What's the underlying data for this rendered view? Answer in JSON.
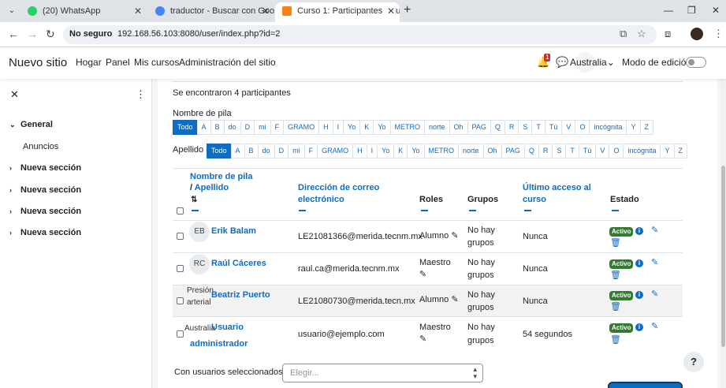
{
  "browser": {
    "tabs": [
      {
        "title": "(20) WhatsApp",
        "close": "✕",
        "color": "#25d366"
      },
      {
        "title": "traductor - Buscar con Google",
        "close": "✕",
        "color": "#4285f4"
      },
      {
        "title": "Curso 1: Participantes | Nuevo s",
        "close": "✕",
        "color": "#f98012"
      }
    ],
    "new_tab": "+",
    "tab_menu": "⌄",
    "window_controls": {
      "minimize": "—",
      "maximize": "❐",
      "close": "✕"
    },
    "nav": {
      "back": "←",
      "forward": "→",
      "reload": "↻"
    },
    "security_label": "No seguro",
    "url": "192.168.56.103:8080/user/index.php?id=2",
    "icons": {
      "translate": "⧉",
      "star": "☆",
      "extensions": "⧈",
      "menu": "⋮"
    }
  },
  "navbar": {
    "site_name": "Nuevo sitio",
    "links": [
      "Hogar",
      "Panel",
      "Mis cursos",
      "Administración del sitio"
    ],
    "notif_count": "1",
    "bell": "🔔",
    "chat": "💬",
    "language": "Australia",
    "lang_caret": "⌄",
    "edit_mode_label": "Modo de edición"
  },
  "drawer": {
    "close": "✕",
    "kebab": "⋮",
    "sections": [
      {
        "label": "General",
        "chev": "⌄"
      },
      {
        "label": "Nueva sección",
        "chev": "›"
      },
      {
        "label": "Nueva sección",
        "chev": "›"
      },
      {
        "label": "Nueva sección",
        "chev": "›"
      },
      {
        "label": "Nueva sección",
        "chev": "›"
      }
    ],
    "sub_item": "Anuncios"
  },
  "main": {
    "found_text": "Se encontraron 4 participantes",
    "first_name_filter_label": "Nombre de pila",
    "last_name_filter_label": "Apellido",
    "first_letters": [
      "Todo",
      "A",
      "B",
      "do",
      "D",
      "mi",
      "F",
      "GRAMO",
      "H",
      "I",
      "Yo",
      "K",
      "Yo",
      "METRO",
      "norte",
      "Oh",
      "PAG",
      "Q",
      "R",
      "S",
      "T",
      "Tú",
      "V",
      "O",
      "incógnita",
      "Y",
      "Z"
    ],
    "last_letters": [
      "Todo",
      "A",
      "B",
      "do",
      "D",
      "mi",
      "F",
      "GRAMO",
      "H",
      "I",
      "Yo",
      "K",
      "Yo",
      "METRO",
      "norte",
      "Oh",
      "PAG",
      "Q",
      "R",
      "S",
      "T",
      "Tú",
      "V",
      "O",
      "incógnita",
      "Y",
      "Z"
    ],
    "headers": {
      "name_line1": "Nombre de pila",
      "name_sep": "/",
      "name_line2": "Apellido",
      "sort_icon": "⇅",
      "email_line1": "Dirección de correo",
      "email_line2": "electrónico",
      "roles": "Roles",
      "groups": "Grupos",
      "last_access_line1": "Último acceso al",
      "last_access_line2": "curso",
      "status": "Estado"
    },
    "rows": [
      {
        "initials": "EB",
        "overlay": "",
        "name_line1": "Erik Balam",
        "name_line2": "",
        "email": "LE21081366@merida.tecnm.mx",
        "role": "Alumno",
        "groups_line1": "No hay",
        "groups_line2": "grupos",
        "last_access": "Nunca",
        "status": "Activo"
      },
      {
        "initials": "RC",
        "overlay": "",
        "name_line1": "Raúl Cáceres",
        "name_line2": "",
        "email": "raul.ca@merida.tecnm.mx",
        "role": "Maestro",
        "groups_line1": "No hay",
        "groups_line2": "grupos",
        "last_access": "Nunca",
        "status": "Activo"
      },
      {
        "initials": "",
        "overlay_line1": "Presión",
        "overlay_line2": "arterial",
        "name_line1": "Beatriz Puerto",
        "name_line2": "",
        "email": "LE21080730@merida.tecn.mx",
        "role": "Alumno",
        "groups_line1": "No hay",
        "groups_line2": "grupos",
        "last_access": "Nunca",
        "status": "Activo"
      },
      {
        "initials": "",
        "overlay_line1": "Australia",
        "overlay_line2": "",
        "name_line1": "Usuario",
        "name_line2": "administrador",
        "email": "usuario@ejemplo.com",
        "role": "Maestro",
        "groups_line1": "No hay",
        "groups_line2": "grupos",
        "last_access": "54 segundos",
        "status": "Activo"
      }
    ],
    "info_icon": "i",
    "pencil_icon": "✎",
    "edit_icon": "✎",
    "trash_icon": "🗑",
    "bulk_label": "Con usuarios seleccionados...",
    "bulk_placeholder": "Elegir...",
    "help": "?"
  }
}
